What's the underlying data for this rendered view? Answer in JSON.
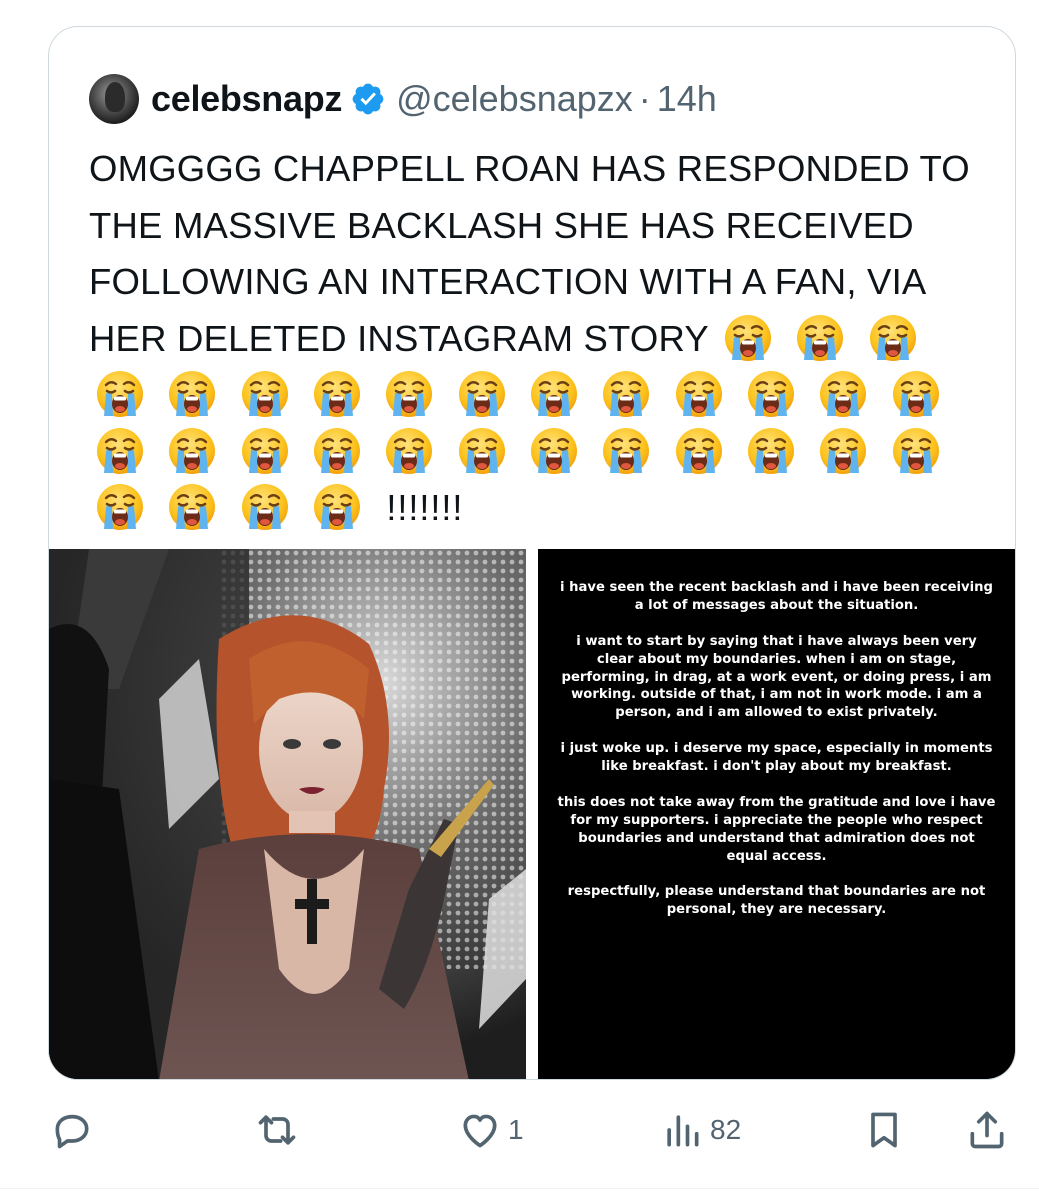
{
  "author": {
    "display_name": "celebsnapz",
    "handle": "@celebsnapzx",
    "separator": "·",
    "time": "14h",
    "verified": true,
    "verified_color": "#1d9bf0"
  },
  "tweet": {
    "text": "OMGGGG CHAPPELL ROAN HAS RESPONDED TO THE MASSIVE BACKLASH SHE HAS RECEIVED FOLLOWING AN INTERACTION WITH A FAN, VIA HER DELETED INSTAGRAM STORY",
    "emoji_name": "loudly-crying-face",
    "emoji_count": 31,
    "suffix": "!!!!!!!"
  },
  "media": {
    "left_photo": "photo of a red-haired woman in a sheer dress with a cross necklace",
    "story_paragraphs": [
      "i have seen the recent backlash and i have been receiving a lot of messages about the situation.",
      "i want to start by saying that i have always been very clear about my boundaries. when i am on stage, performing, in drag, at a work event, or doing press, i am working. outside of that, i am not in work mode. i am a person, and i am allowed to exist privately.",
      "i just woke up. i deserve my space, especially in moments like breakfast. i don't play about my breakfast.",
      "this does not take away from the gratitude and love i have for my supporters. i appreciate the people who respect boundaries and understand that admiration does not equal access.",
      "respectfully, please understand that boundaries are not personal, they are necessary."
    ]
  },
  "actions": {
    "reply_icon": "reply-icon",
    "retweet_icon": "retweet-icon",
    "like_icon": "heart-icon",
    "like_count": "1",
    "views_icon": "views-icon",
    "views_count": "82",
    "bookmark_icon": "bookmark-icon",
    "share_icon": "share-icon"
  },
  "colors": {
    "text": "#0f1419",
    "secondary": "#536471",
    "border": "#cfd9de"
  }
}
